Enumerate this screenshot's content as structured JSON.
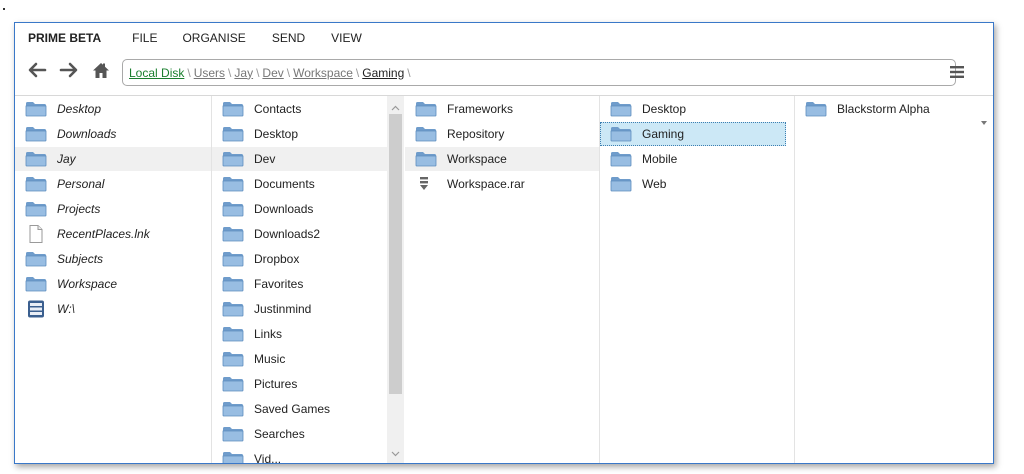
{
  "menubar": {
    "brand": "PRIME BETA",
    "items": [
      "FILE",
      "ORGANISE",
      "SEND",
      "VIEW"
    ]
  },
  "nav": {
    "back_icon": "arrow-left-icon",
    "forward_icon": "arrow-right-icon",
    "home_icon": "home-icon",
    "menu_icon": "hamburger-menu-icon"
  },
  "address": {
    "crumbs": [
      "Local Disk",
      "Users",
      "Jay",
      "Dev",
      "Workspace",
      "Gaming"
    ],
    "separator": "\\"
  },
  "columns": [
    {
      "items": [
        {
          "label": "Desktop",
          "icon": "folder-icon",
          "italic": true
        },
        {
          "label": "Downloads",
          "icon": "folder-icon",
          "italic": true
        },
        {
          "label": "Jay",
          "icon": "folder-icon",
          "italic": true,
          "selected": true
        },
        {
          "label": "Personal",
          "icon": "folder-icon",
          "italic": true
        },
        {
          "label": "Projects",
          "icon": "folder-icon",
          "italic": true
        },
        {
          "label": "RecentPlaces.lnk",
          "icon": "file-icon",
          "italic": true
        },
        {
          "label": "Subjects",
          "icon": "folder-icon",
          "italic": true
        },
        {
          "label": "Workspace",
          "icon": "folder-icon",
          "italic": true
        },
        {
          "label": "W:\\",
          "icon": "drive-icon",
          "italic": true
        }
      ]
    },
    {
      "items": [
        {
          "label": "Contacts",
          "icon": "folder-icon"
        },
        {
          "label": "Desktop",
          "icon": "folder-icon"
        },
        {
          "label": "Dev",
          "icon": "folder-icon",
          "selected": true
        },
        {
          "label": "Documents",
          "icon": "folder-icon"
        },
        {
          "label": "Downloads",
          "icon": "folder-icon"
        },
        {
          "label": "Downloads2",
          "icon": "folder-icon"
        },
        {
          "label": "Dropbox",
          "icon": "folder-icon"
        },
        {
          "label": "Favorites",
          "icon": "folder-icon"
        },
        {
          "label": "Justinmind",
          "icon": "folder-icon"
        },
        {
          "label": "Links",
          "icon": "folder-icon"
        },
        {
          "label": "Music",
          "icon": "folder-icon"
        },
        {
          "label": "Pictures",
          "icon": "folder-icon"
        },
        {
          "label": "Saved Games",
          "icon": "folder-icon"
        },
        {
          "label": "Searches",
          "icon": "folder-icon"
        },
        {
          "label": "Vid...",
          "icon": "folder-icon"
        }
      ]
    },
    {
      "items": [
        {
          "label": "Frameworks",
          "icon": "folder-icon"
        },
        {
          "label": "Repository",
          "icon": "folder-icon"
        },
        {
          "label": "Workspace",
          "icon": "folder-icon",
          "selected": true
        },
        {
          "label": "Workspace.rar",
          "icon": "archive-icon"
        }
      ]
    },
    {
      "items": [
        {
          "label": "Desktop",
          "icon": "folder-icon"
        },
        {
          "label": "Gaming",
          "icon": "folder-icon",
          "highlighted": true
        },
        {
          "label": "Mobile",
          "icon": "folder-icon"
        },
        {
          "label": "Web",
          "icon": "folder-icon"
        }
      ]
    },
    {
      "items": [
        {
          "label": "Blackstorm Alpha",
          "icon": "folder-icon"
        }
      ]
    }
  ],
  "colors": {
    "accent": "#3a78c8",
    "selection": "#cce8f6",
    "selected_row": "#f0f0f0",
    "breadcrumb_root": "#1a7f2e",
    "folder": "#7ea7cf"
  }
}
